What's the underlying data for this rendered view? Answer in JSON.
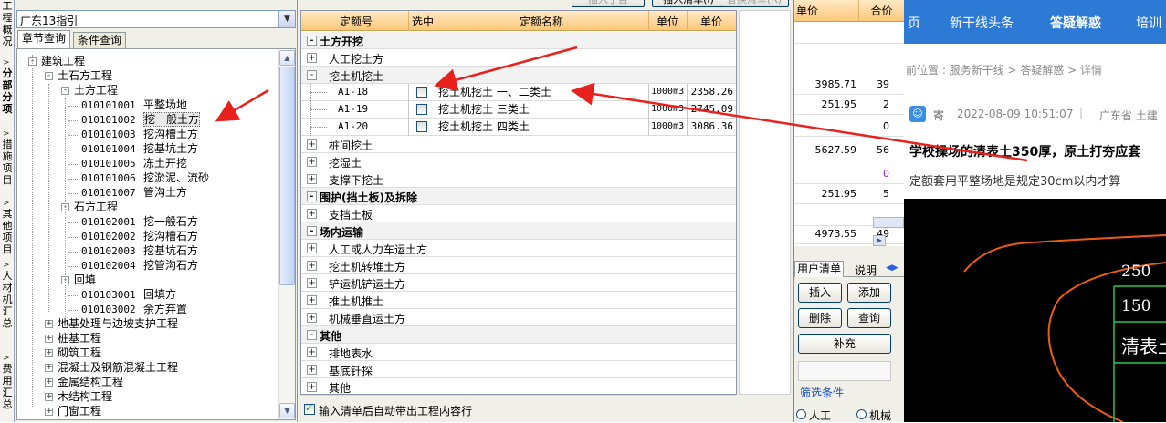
{
  "left_strip": {
    "groups": [
      {
        "text": "工程概况",
        "bold": false
      },
      {
        "text": "分部分项",
        "bold": true
      },
      {
        "text": "措施项目",
        "bold": false
      },
      {
        "text": "其他项目",
        "bold": false
      },
      {
        "text": "人材机汇总",
        "bold": false
      },
      {
        "text": "费用汇总",
        "bold": false
      }
    ]
  },
  "left_panel": {
    "province": "广东13指引",
    "tabs": [
      "章节查询",
      "条件查询"
    ],
    "tree": [
      {
        "label": "建筑工程",
        "code": "",
        "level": 0,
        "expand": "-"
      },
      {
        "label": "土石方工程",
        "code": "",
        "level": 1,
        "expand": "-"
      },
      {
        "label": "土方工程",
        "code": "",
        "level": 2,
        "expand": "-"
      },
      {
        "label": "平整场地",
        "code": "010101001",
        "level": 3,
        "expand": ""
      },
      {
        "label": "挖一般土方",
        "code": "010101002",
        "level": 3,
        "expand": "",
        "selected": true
      },
      {
        "label": "挖沟槽土方",
        "code": "010101003",
        "level": 3,
        "expand": ""
      },
      {
        "label": "挖基坑土方",
        "code": "010101004",
        "level": 3,
        "expand": ""
      },
      {
        "label": "冻土开挖",
        "code": "010101005",
        "level": 3,
        "expand": ""
      },
      {
        "label": "挖淤泥、流砂",
        "code": "010101006",
        "level": 3,
        "expand": ""
      },
      {
        "label": "管沟土方",
        "code": "010101007",
        "level": 3,
        "expand": ""
      },
      {
        "label": "石方工程",
        "code": "",
        "level": 2,
        "expand": "-"
      },
      {
        "label": "挖一般石方",
        "code": "010102001",
        "level": 3,
        "expand": ""
      },
      {
        "label": "挖沟槽石方",
        "code": "010102002",
        "level": 3,
        "expand": ""
      },
      {
        "label": "挖基坑石方",
        "code": "010102003",
        "level": 3,
        "expand": ""
      },
      {
        "label": "挖管沟石方",
        "code": "010102004",
        "level": 3,
        "expand": ""
      },
      {
        "label": "回填",
        "code": "",
        "level": 2,
        "expand": "-"
      },
      {
        "label": "回填方",
        "code": "010103001",
        "level": 3,
        "expand": ""
      },
      {
        "label": "余方弃置",
        "code": "010103002",
        "level": 3,
        "expand": ""
      },
      {
        "label": "地基处理与边坡支护工程",
        "code": "",
        "level": 1,
        "expand": "+"
      },
      {
        "label": "桩基工程",
        "code": "",
        "level": 1,
        "expand": "+"
      },
      {
        "label": "砌筑工程",
        "code": "",
        "level": 1,
        "expand": "+"
      },
      {
        "label": "混凝土及钢筋混凝土工程",
        "code": "",
        "level": 1,
        "expand": "+"
      },
      {
        "label": "金属结构工程",
        "code": "",
        "level": 1,
        "expand": "+"
      },
      {
        "label": "木结构工程",
        "code": "",
        "level": 1,
        "expand": "+"
      },
      {
        "label": "门窗工程",
        "code": "",
        "level": 1,
        "expand": "+"
      }
    ]
  },
  "middle_panel": {
    "top_buttons": [
      "插入子目",
      "插入清单(I)",
      "替换清单(R)"
    ],
    "headers": [
      "定额号",
      "选中",
      "定额名称",
      "单位",
      "单价"
    ],
    "rows": [
      {
        "type": "cat",
        "expand": "-",
        "label": "土方开挖"
      },
      {
        "type": "sub",
        "expand": "+",
        "label": "人工挖土方"
      },
      {
        "type": "sub",
        "expand": "-",
        "label": "挖土机挖土",
        "highlight": true
      },
      {
        "type": "item",
        "code": "A1-18",
        "name": "挖土机挖土 一、二类土",
        "unit": "1000m3",
        "price": "2358.26"
      },
      {
        "type": "item",
        "code": "A1-19",
        "name": "挖土机挖土 三类土",
        "unit": "1000m3",
        "price": "2745.09"
      },
      {
        "type": "item",
        "code": "A1-20",
        "name": "挖土机挖土 四类土",
        "unit": "1000m3",
        "price": "3086.36"
      },
      {
        "type": "sub",
        "expand": "+",
        "label": "桩间挖土"
      },
      {
        "type": "sub",
        "expand": "+",
        "label": "挖湿土"
      },
      {
        "type": "sub",
        "expand": "+",
        "label": "支撑下挖土"
      },
      {
        "type": "cat",
        "expand": "-",
        "label": "围护(挡土板)及拆除"
      },
      {
        "type": "sub",
        "expand": "+",
        "label": "支挡土板"
      },
      {
        "type": "cat",
        "expand": "-",
        "label": "场内运输"
      },
      {
        "type": "sub",
        "expand": "+",
        "label": "人工或人力车运土方"
      },
      {
        "type": "sub",
        "expand": "+",
        "label": "挖土机转堆土方"
      },
      {
        "type": "sub",
        "expand": "+",
        "label": "铲运机铲运土方"
      },
      {
        "type": "sub",
        "expand": "+",
        "label": "推土机推土"
      },
      {
        "type": "sub",
        "expand": "+",
        "label": "机械垂直运土方"
      },
      {
        "type": "cat",
        "expand": "-",
        "label": "其他"
      },
      {
        "type": "sub",
        "expand": "+",
        "label": "排地表水"
      },
      {
        "type": "sub",
        "expand": "+",
        "label": "基底钎探"
      },
      {
        "type": "sub",
        "expand": "+",
        "label": "其他"
      }
    ],
    "footer_checkbox": "输入清单后自动带出工程内容行"
  },
  "right_app": {
    "headers": [
      "单价",
      "合价"
    ],
    "rows": [
      {
        "price": "",
        "total": ""
      },
      {
        "price": "3985.71",
        "total": "39"
      },
      {
        "price": "251.95",
        "total": "2"
      },
      {
        "price": "",
        "total": "0"
      },
      {
        "price": "5627.59",
        "total": "56"
      },
      {
        "price": "",
        "total": "0"
      },
      {
        "price": "251.95",
        "total": "5"
      },
      {
        "price": "",
        "total": ""
      },
      {
        "price": "4973.55",
        "total": "49"
      }
    ],
    "tabs": [
      "用户清单",
      "说明"
    ],
    "buttons": {
      "insert": "插入",
      "add": "添加",
      "delete": "删除",
      "query": "查询",
      "supplement": "补充"
    },
    "filter_label": "筛选条件",
    "radios": [
      "人工",
      "机械"
    ]
  },
  "website": {
    "nav": [
      "页",
      "新干线头条",
      "答疑解惑",
      "培训"
    ],
    "nav_active": 2,
    "breadcrumb": "前位置 : 服务新干线 > 答疑解惑 > 详情",
    "author": "寄",
    "datetime": "2022-08-09 10:51:07",
    "location": "广东省 土建",
    "question": "学校操场的清表土350厚，原土打夯应套",
    "answer": "定额套用平整场地是规定30cm以内才算",
    "cad_labels": [
      "250",
      "150",
      "清表土"
    ]
  },
  "colors": {
    "header_orange": "#fdc879",
    "nav_blue": "#2c79d6",
    "arrow_red": "#e8211c",
    "cad_orange": "#e85d12",
    "cad_green": "#22c55e"
  }
}
